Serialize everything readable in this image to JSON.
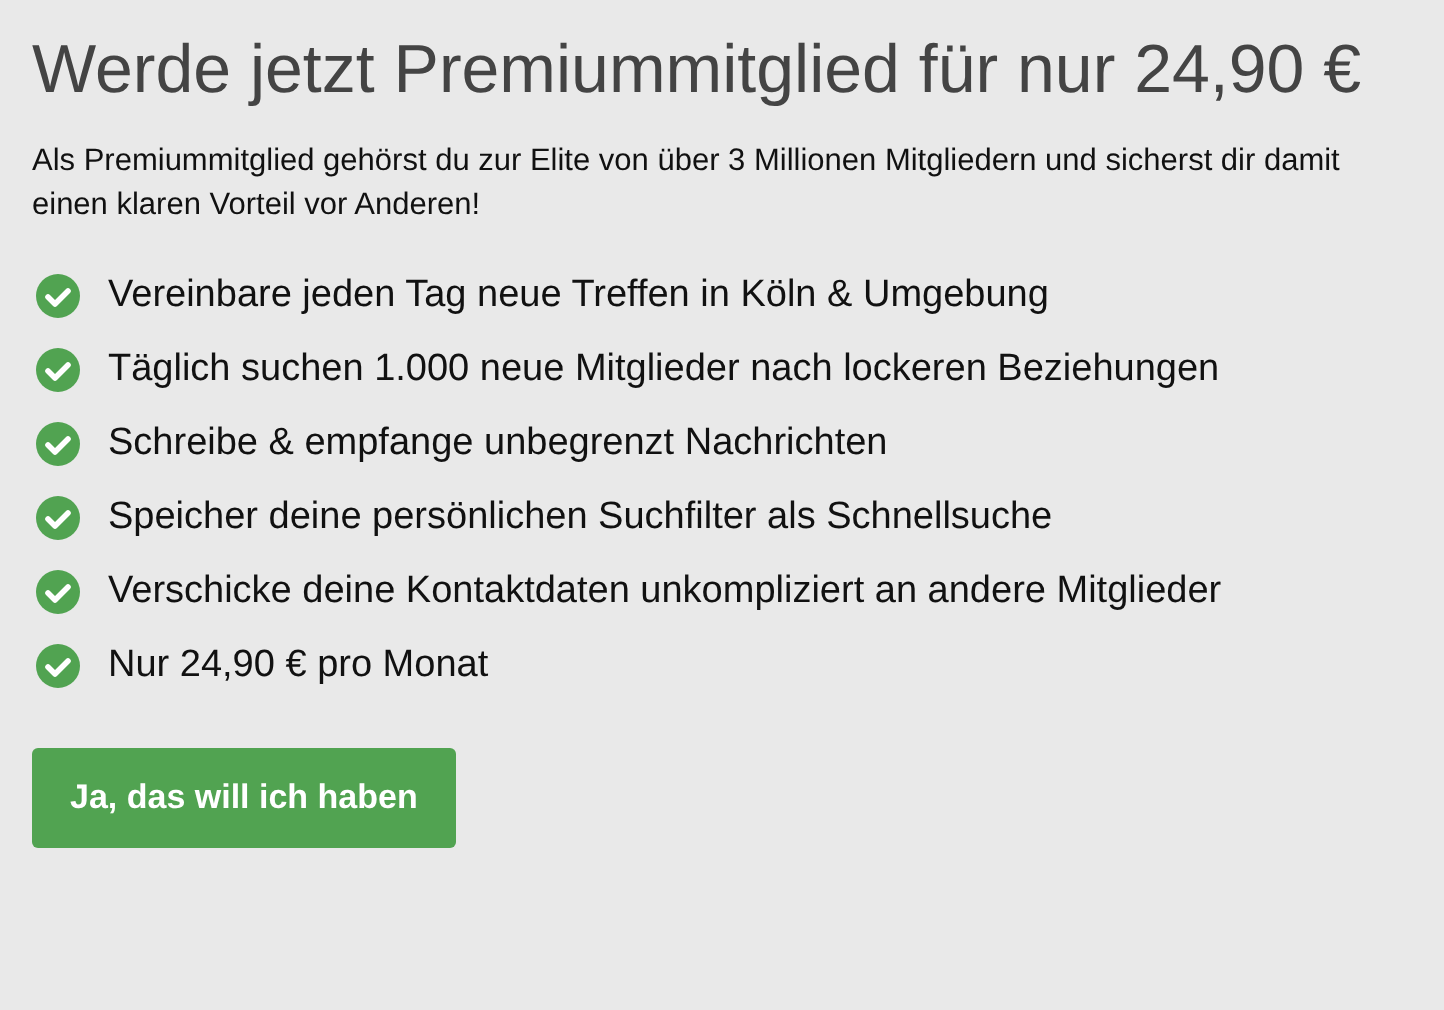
{
  "title": "Werde jetzt Premiummitglied für nur 24,90 €",
  "intro": "Als Premiummitglied gehörst du zur Elite von über 3 Millionen Mitgliedern und sicherst dir damit einen klaren Vorteil vor Anderen!",
  "benefits": [
    "Vereinbare jeden Tag neue Treffen in Köln & Umgebung",
    "Täglich suchen 1.000 neue Mitglieder nach lockeren Beziehungen",
    "Schreibe & empfange unbegrenzt Nachrichten",
    "Speicher deine persönlichen Suchfilter als Schnellsuche",
    "Verschicke deine Kontaktdaten unkompliziert an andere Mitglieder",
    "Nur 24,90 € pro Monat"
  ],
  "button": "Ja, das will ich haben"
}
